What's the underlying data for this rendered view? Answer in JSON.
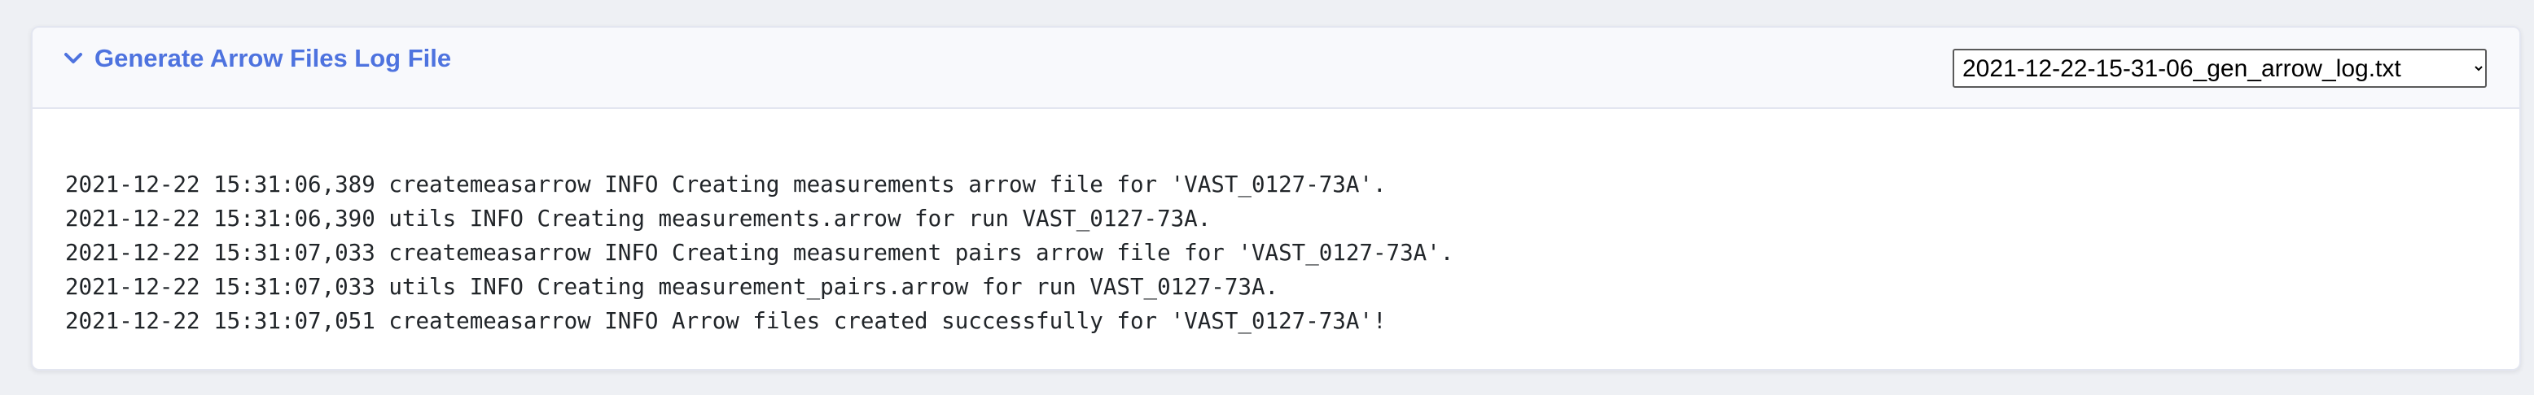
{
  "panel": {
    "title": "Generate Arrow Files Log File",
    "icon": "chevron-down-icon",
    "accent_color": "#4e73df",
    "select": {
      "selected": "2021-12-22-15-31-06_gen_arrow_log.txt",
      "options": [
        "2021-12-22-15-31-06_gen_arrow_log.txt"
      ]
    }
  },
  "log": {
    "lines": [
      "2021-12-22 15:31:06,389 createmeasarrow INFO Creating measurements arrow file for 'VAST_0127-73A'.",
      "2021-12-22 15:31:06,390 utils INFO Creating measurements.arrow for run VAST_0127-73A.",
      "2021-12-22 15:31:07,033 createmeasarrow INFO Creating measurement pairs arrow file for 'VAST_0127-73A'.",
      "2021-12-22 15:31:07,033 utils INFO Creating measurement_pairs.arrow for run VAST_0127-73A.",
      "2021-12-22 15:31:07,051 createmeasarrow INFO Arrow files created successfully for 'VAST_0127-73A'!"
    ]
  }
}
